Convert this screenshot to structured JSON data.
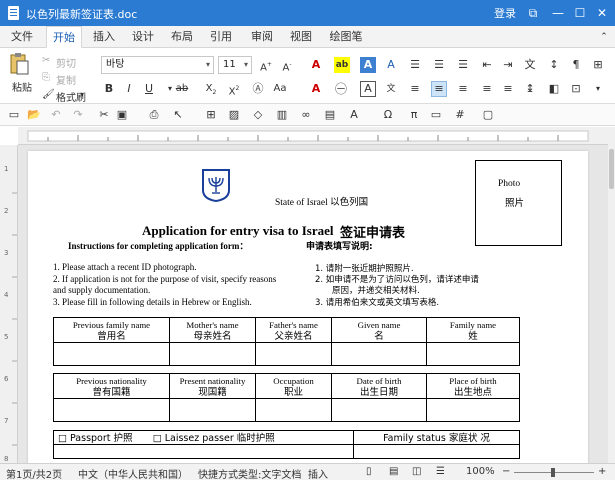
{
  "window": {
    "title": "以色列最新签证表.doc",
    "login": "登录"
  },
  "menu": {
    "tabs": [
      "文件",
      "开始",
      "插入",
      "设计",
      "布局",
      "引用",
      "审阅",
      "视图",
      "绘图笔"
    ]
  },
  "ribbon": {
    "paste": "粘贴",
    "cut": "剪切",
    "copy": "复制",
    "format_painter": "格式刷",
    "font_name": "바탕",
    "font_size": "11"
  },
  "document": {
    "photo": "Photo",
    "photo_cn": "照片",
    "state": "State of  Israel 以色列国",
    "heading": "Application for entry visa to Israel",
    "heading_cn": "签证申请表",
    "instr_heading": "Instructions for completing application form：",
    "instr_heading_cn": "申请表填写说明:",
    "instructions": [
      "1. Please attach a recent ID photograph.",
      "2. If application is not for the purpose of visit, specify reasons",
      "and supply documentation.",
      "3. Please fill in following details in Hebrew or English."
    ],
    "instructions_cn": [
      "1.     请附一张近期护照照片.",
      "2.     如申请不是为了访问以色列，请详述申请",
      "原因，并递交相关材料.",
      "3.     请用希伯来文或英文填写表格."
    ],
    "table1_headers": [
      [
        "Previous family name",
        "曾用名"
      ],
      [
        "Mother's name",
        "母亲姓名"
      ],
      [
        "Father's name",
        "父亲姓名"
      ],
      [
        "Given name",
        "名"
      ],
      [
        "Family name",
        "姓"
      ]
    ],
    "table2_headers": [
      [
        "Previous nationality",
        "曾有国籍"
      ],
      [
        "Present nationality",
        "现国籍"
      ],
      [
        "Occupation",
        "职业"
      ],
      [
        "Date of birth",
        "出生日期"
      ],
      [
        "Place of birth",
        "出生地点"
      ]
    ],
    "table3": {
      "passport": "□ Passport    护照",
      "laissez": "□  Laissez  passer    临时护照",
      "family_status": "Family status 家庭状 况"
    }
  },
  "status": {
    "page": "第1页/共2页",
    "language": "中文（中华人民共和国）",
    "mode": "快捷方式类型:文字文档",
    "insert": "插入",
    "zoom": "100%"
  }
}
